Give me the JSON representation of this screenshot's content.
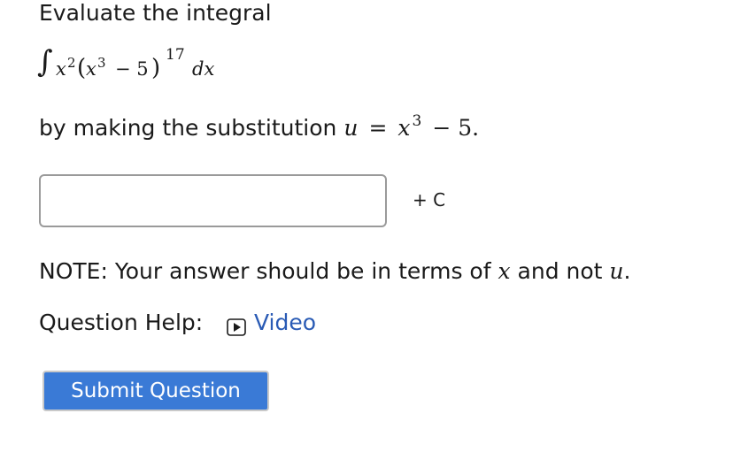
{
  "question": {
    "prompt": "Evaluate the integral",
    "integral": {
      "sign": "∫",
      "x": "x",
      "two": "2",
      "lparen": "(",
      "x_inner": "x",
      "three": "3",
      "minus_five": "− 5",
      "rparen": ")",
      "power": "17",
      "dx": "dx"
    },
    "substitution": {
      "text": "by making the substitution ",
      "u": "u",
      "equals": "=",
      "x": "x",
      "power": "3",
      "rest": "− 5."
    }
  },
  "answer": {
    "value": "",
    "placeholder": "",
    "suffix": "+ C"
  },
  "note": {
    "text_before": "NOTE: Your answer should be in terms of ",
    "x": "x",
    "text_middle": " and not ",
    "u": "u",
    "text_after": "."
  },
  "help": {
    "label": "Question Help:",
    "video_label": "Video",
    "video_icon": "play-icon"
  },
  "submit": {
    "label": "Submit Question"
  },
  "colors": {
    "link": "#2a5bb5",
    "button_bg": "#3a7ad6",
    "button_text": "#ffffff",
    "input_border": "#9a9a9a"
  }
}
